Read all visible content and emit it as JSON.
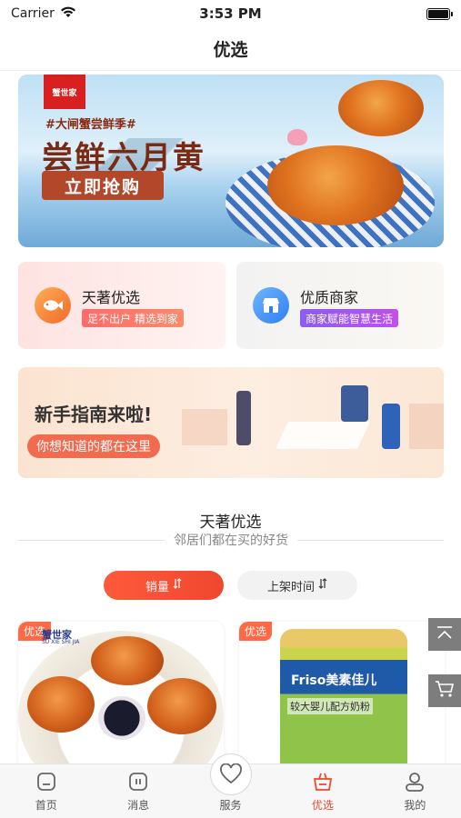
{
  "status_bar": {
    "carrier": "Carrier",
    "time": "3:53 PM"
  },
  "nav": {
    "title": "优选"
  },
  "banner": {
    "logo_text": "蟹世家",
    "tag": "#大闸蟹尝鲜季#",
    "headline": "尝鲜六月黄",
    "cta": "立即抢购"
  },
  "feature_cards": [
    {
      "title": "天著优选",
      "chip": "足不出户 精选到家",
      "icon": "fish-icon"
    },
    {
      "title": "优质商家",
      "chip": "商家赋能智慧生活",
      "icon": "store-icon"
    }
  ],
  "guide": {
    "title": "新手指南来啦!",
    "pill": "你想知道的都在这里"
  },
  "section": {
    "title": "天著优选",
    "subtitle": "邻居们都在买的好货"
  },
  "sort": {
    "sales_label": "销量",
    "listing_time_label": "上架时间",
    "active": "sales"
  },
  "products": [
    {
      "badge": "优选",
      "brand": "蟹世家",
      "brand_sub": "SU XIE SHI JIA"
    },
    {
      "badge": "优选",
      "brand": "Friso美素佳儿",
      "line2": "较大婴儿配方奶粉"
    }
  ],
  "float_buttons": [
    {
      "icon": "back-to-top-icon"
    },
    {
      "icon": "cart-icon"
    }
  ],
  "tabs": [
    {
      "label": "首页",
      "icon": "home-icon"
    },
    {
      "label": "消息",
      "icon": "message-icon"
    },
    {
      "label": "服务",
      "icon": "heart-icon"
    },
    {
      "label": "优选",
      "icon": "basket-icon"
    },
    {
      "label": "我的",
      "icon": "user-icon"
    }
  ],
  "colors": {
    "accent": "#f0472f",
    "active_tab": "#f0472f"
  }
}
